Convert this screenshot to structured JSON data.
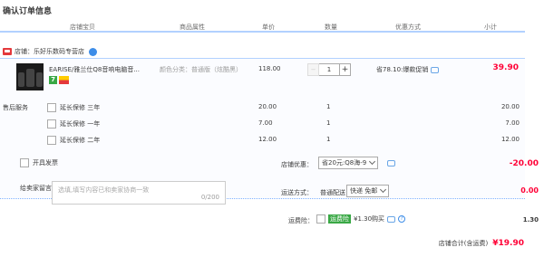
{
  "page_title": "确认订单信息",
  "columns": [
    "店铺宝贝",
    "商品属性",
    "单价",
    "数量",
    "优惠方式",
    "小计"
  ],
  "store": {
    "label": "店铺：乐好乐数码专营店"
  },
  "item": {
    "name": "EARISE/雅兰仕Q8音响电脑音...",
    "attributes": "颜色分类：普通版（炫酷黑）",
    "tag_7": "7",
    "unit_price": "118.00",
    "quantity": "1",
    "minus": "−",
    "plus": "+",
    "promotion": "省78.10:爆款促销",
    "subtotal": "39.90"
  },
  "services": {
    "label": "售后服务",
    "rows": [
      {
        "name": "延长保修 三年",
        "price": "20.00",
        "qty": "1",
        "subtotal": "20.00"
      },
      {
        "name": "延长保修 一年",
        "price": "7.00",
        "qty": "1",
        "subtotal": "7.00"
      },
      {
        "name": "延长保修 二年",
        "price": "12.00",
        "qty": "1",
        "subtotal": "12.00"
      }
    ]
  },
  "invoice": {
    "label": "开具发票"
  },
  "store_discount": {
    "label": "店铺优惠：",
    "selected": "省20元:Q8海-9",
    "amount": "-20.00"
  },
  "message": {
    "label": "给卖家留言：",
    "placeholder": "选填,填写内容已和卖家协商一致",
    "counter": "0/200"
  },
  "shipping": {
    "label": "运送方式：",
    "method": "普通配送",
    "selected": "快递 免邮",
    "amount": "0.00"
  },
  "insurance": {
    "label": "运费险：",
    "badge": "运费险",
    "text": "¥1.30购买",
    "help": "?",
    "amount": "1.30"
  },
  "total": {
    "label": "店铺合计(含运费)",
    "amount": "¥19.90"
  },
  "colors": {
    "accent_red": "#ff0036",
    "header_border": "#b2d1ff",
    "link_blue": "#3d8de8",
    "green": "#39a845"
  }
}
